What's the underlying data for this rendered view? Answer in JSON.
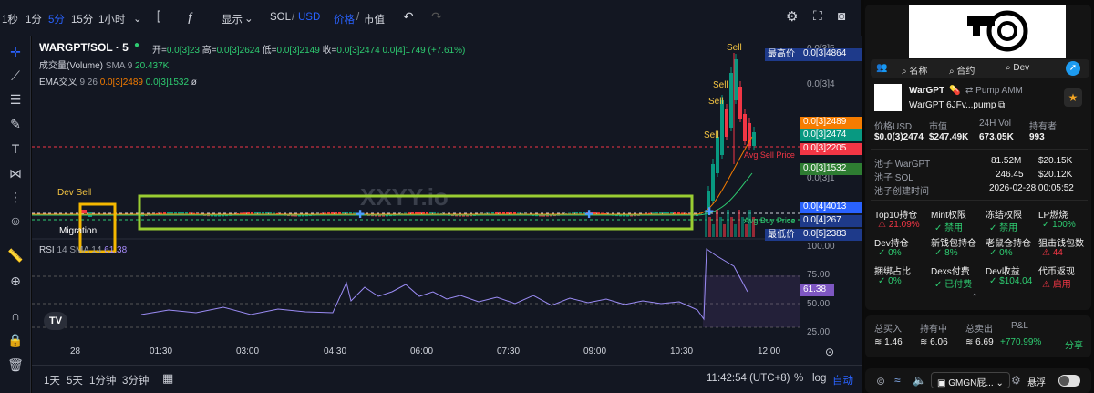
{
  "toolbar": {
    "intervals": [
      "1秒",
      "1分",
      "5分",
      "15分",
      "1小时"
    ],
    "active_interval": "5分",
    "display_label": "显示",
    "sol_label": "SOL",
    "usd_label": "USD",
    "price_label": "价格",
    "mcap_label": "市值",
    "colors": {
      "accent": "#2962ff",
      "bg": "#131722"
    }
  },
  "legend": {
    "symbol": "WARGPT/SOL · 5",
    "open_label": "开=",
    "open_val": "0.0[3]23",
    "high_label": "高=",
    "high_val": "0.0[3]2624",
    "low_label": "低=",
    "low_val": "0.0[3]2149",
    "close_label": "收=",
    "close_val": "0.0[3]2474",
    "change": "0.0[4]1749 (+7.61%)",
    "volume_label": "成交量(Volume)",
    "volume_sma": "SMA 9",
    "volume_val": "20.437K",
    "ema_label": "EMA交叉",
    "ema_params": "9 26",
    "ema_val1": "0.0[3]2489",
    "ema_val2": "0.0[3]1532",
    "ema_extra": "ø",
    "rsi_label": "RSI",
    "rsi_params": "14 SMA 14",
    "rsi_val": "61.38"
  },
  "chart_data": {
    "type": "candlestick",
    "price_axis_ticks": [
      "0.0[3]5",
      "0.0[3]4",
      "0.0[3]3",
      "0.0[3]2",
      "0.0[3]1",
      "0.0[4]5"
    ],
    "price_tags": [
      {
        "label": "最高价",
        "value": "0.0[3]4864",
        "color": "#1e3a8a"
      },
      {
        "value": "0.0[3]2489",
        "color": "#f57c00"
      },
      {
        "value": "0.0[3]2474",
        "color": "#089981"
      },
      {
        "value": "0.0[3]2205",
        "color": "#f23645",
        "label": "Avg Sell Price"
      },
      {
        "value": "0.0[3]1532",
        "color": "#2e7d32"
      },
      {
        "value": "0.0[4]4013",
        "color": "#2962ff"
      },
      {
        "value": "0.0[4]267",
        "color": "#1e3a8a",
        "label": "Avg Buy Price"
      },
      {
        "label": "最低价",
        "value": "0.0[5]2383",
        "color": "#1e3a8a"
      }
    ],
    "rsi_ticks": [
      "100.00",
      "75.00",
      "50.00",
      "25.00"
    ],
    "rsi_value": "61.38",
    "time_ticks": [
      "28",
      "01:30",
      "03:00",
      "04:30",
      "06:00",
      "07:30",
      "09:00",
      "10:30",
      "12:00"
    ],
    "annotations": {
      "dev_sell": "Dev Sell",
      "migration": "Migration",
      "sell": "Sell",
      "watermark": "XXYY.io"
    }
  },
  "bottom": {
    "ranges": [
      "1天",
      "5天",
      "1分钟",
      "3分钟"
    ],
    "clock": "11:42:54 (UTC+8)",
    "pct": "%",
    "log": "log",
    "auto": "自动"
  },
  "right": {
    "tabs": [
      "名称",
      "合约",
      "Dev"
    ],
    "token_name": "WarGPT",
    "token_sub": "WarGPT 6JFv...pump",
    "amm": "Pump AMM",
    "stats_labels": [
      "价格USD",
      "市值",
      "24H Vol",
      "持有者"
    ],
    "stats_values": [
      "$0.0(3)2474",
      "$247.49K",
      "673.05K",
      "993"
    ],
    "pool": [
      {
        "label": "池子 WarGPT",
        "v1": "81.52M",
        "v2": "$20.15K"
      },
      {
        "label": "池子 SOL",
        "v1": "246.45",
        "v2": "$20.12K"
      },
      {
        "label": "池子创建时间",
        "v1": "2026-02-28 00:05:52",
        "v2": ""
      }
    ],
    "metrics": [
      {
        "label": "Top10持仓",
        "value": "21.09%",
        "color": "#f23645"
      },
      {
        "label": "Mint权限",
        "value": "禁用",
        "color": "#2ecc71"
      },
      {
        "label": "冻结权限",
        "value": "禁用",
        "color": "#2ecc71"
      },
      {
        "label": "LP燃烧",
        "value": "100%",
        "color": "#2ecc71"
      },
      {
        "label": "Dev持仓",
        "value": "0%",
        "color": "#2ecc71"
      },
      {
        "label": "新钱包持仓",
        "value": "8%",
        "color": "#2ecc71"
      },
      {
        "label": "老鼠仓持仓",
        "value": "0%",
        "color": "#2ecc71"
      },
      {
        "label": "狙击钱包数",
        "value": "44",
        "color": "#f23645"
      },
      {
        "label": "捆绑占比",
        "value": "0%",
        "color": "#2ecc71"
      },
      {
        "label": "Dexs付费",
        "value": "已付费",
        "color": "#2ecc71"
      },
      {
        "label": "Dev收益",
        "value": "$104.04",
        "color": "#2ecc71"
      },
      {
        "label": "代币返现",
        "value": "启用",
        "color": "#f23645"
      }
    ],
    "pnl_labels": [
      "总买入",
      "持有中",
      "总卖出",
      "P&L"
    ],
    "pnl_values": [
      "1.46",
      "6.06",
      "6.69",
      "+770.99%"
    ],
    "share": "分享",
    "footer_brand": "GMGN屁...",
    "footer_float": "悬浮"
  }
}
